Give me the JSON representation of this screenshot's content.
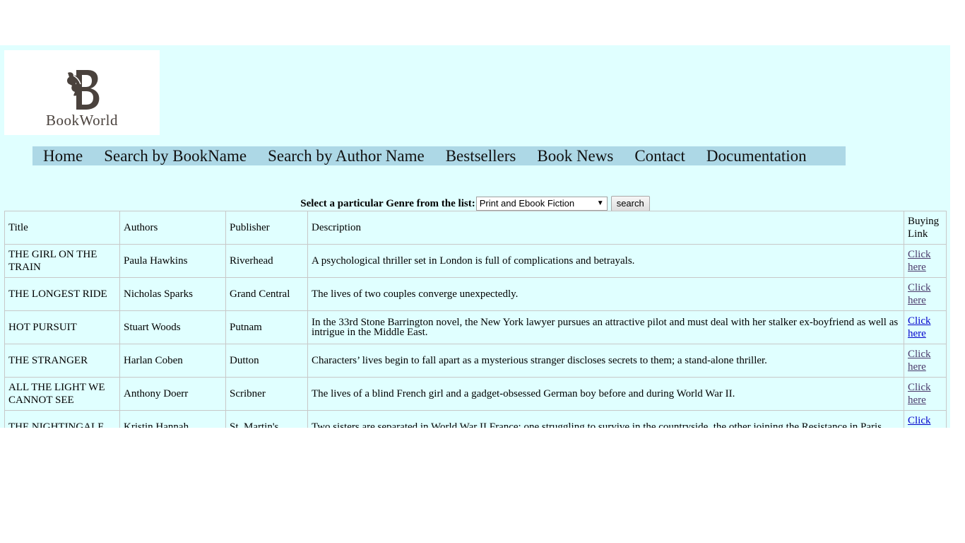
{
  "logo": {
    "text": "BookWorld",
    "icon": "horse-b-logo-icon"
  },
  "nav": {
    "items": [
      "Home",
      "Search by BookName",
      "Search by Author Name",
      "Bestsellers",
      "Book News",
      "Contact",
      "Documentation"
    ]
  },
  "genre": {
    "label": "Select a particular Genre from the list:",
    "selected": "Print and Ebook Fiction",
    "button": "search"
  },
  "table": {
    "headers": [
      "Title",
      "Authors",
      "Publisher",
      "Description",
      "Buying Link"
    ],
    "rows": [
      {
        "title": "THE GIRL ON THE TRAIN",
        "author": "Paula Hawkins",
        "publisher": "Riverhead",
        "description": "A psychological thriller set in London is full of complications and betrayals.",
        "link": "Click here"
      },
      {
        "title": "THE LONGEST RIDE",
        "author": "Nicholas Sparks",
        "publisher": "Grand Central",
        "description": "The lives of two couples converge unexpectedly.",
        "link": "Click here"
      },
      {
        "title": "HOT PURSUIT",
        "author": "Stuart Woods",
        "publisher": "Putnam",
        "description": "In the 33rd Stone Barrington novel, the New York lawyer pursues an attractive pilot and must deal with her stalker ex-boyfriend as well as intrigue in the Middle East.",
        "link": "Click here"
      },
      {
        "title": "THE STRANGER",
        "author": "Harlan Coben",
        "publisher": "Dutton",
        "description": "Characters’ lives begin to fall apart as a mysterious stranger discloses secrets to them; a stand-alone thriller.",
        "link": "Click here"
      },
      {
        "title": "ALL THE LIGHT WE CANNOT SEE",
        "author": "Anthony Doerr",
        "publisher": "Scribner",
        "description": "The lives of a blind French girl and a gadget-obsessed German boy before and during World War II.",
        "link": "Click here"
      },
      {
        "title": "THE NIGHTINGALE",
        "author": "Kristin Hannah",
        "publisher": "St. Martin's",
        "description": "Two sisters are separated in World War II France: one struggling to survive in the countryside, the other joining the Resistance in Paris.",
        "link": "Click here"
      }
    ]
  },
  "colors": {
    "page_background": "#e0ffff",
    "nav_background": "#add8e6",
    "logo_text": "#4a423d"
  }
}
